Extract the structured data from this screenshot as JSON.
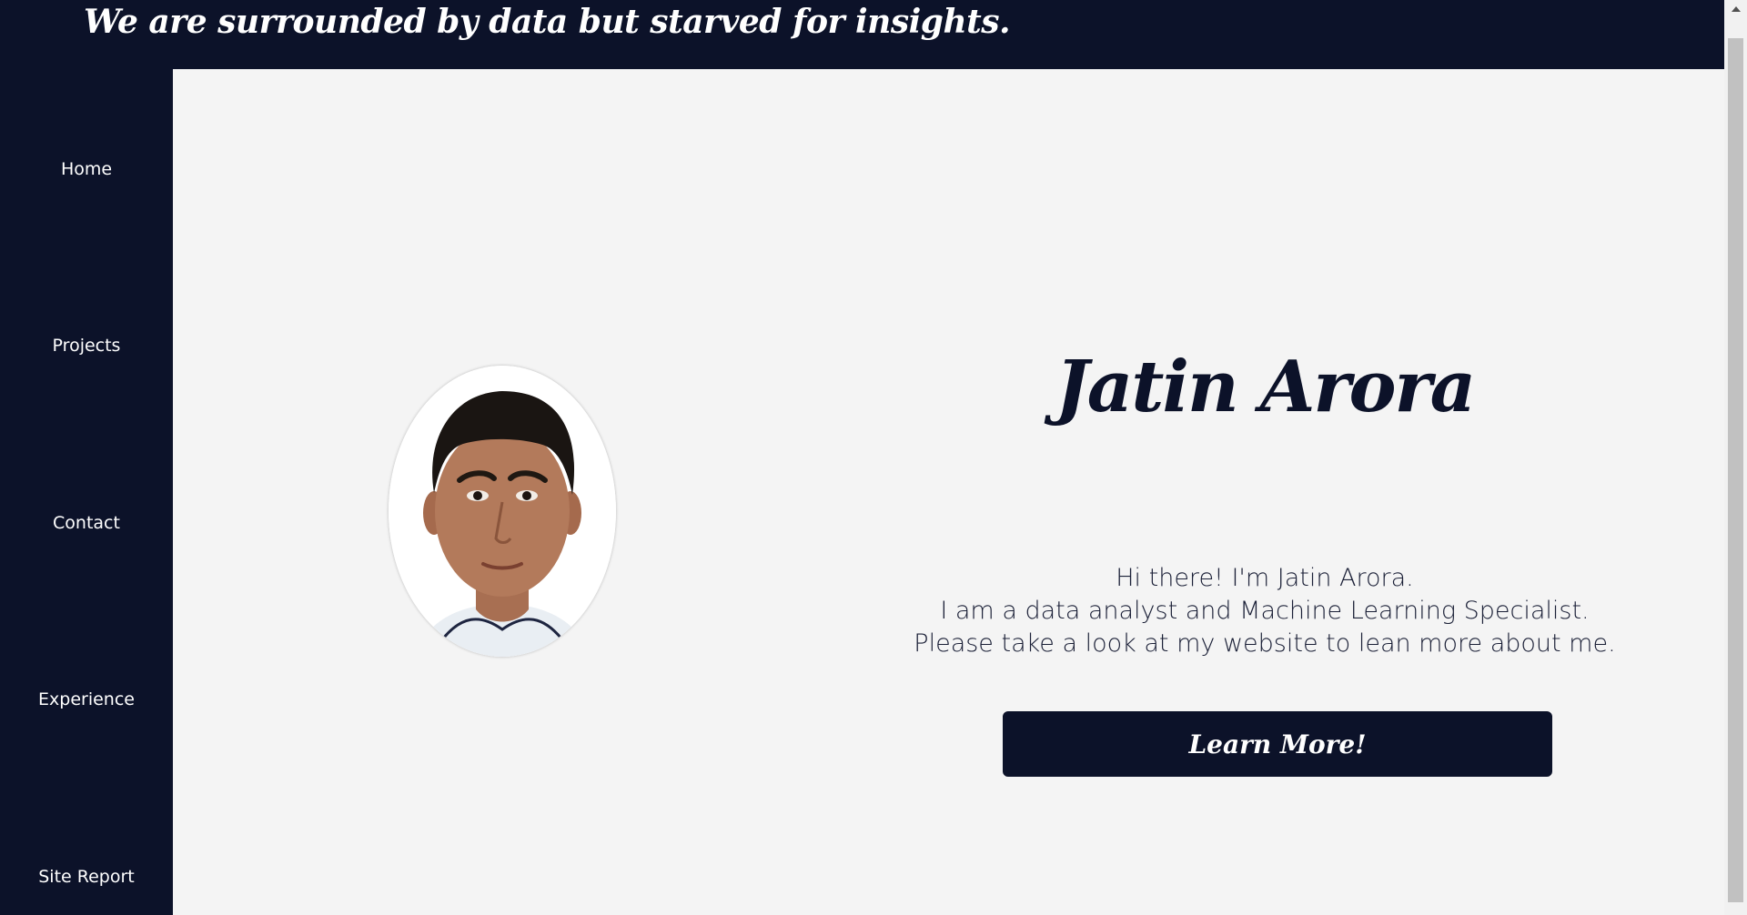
{
  "header": {
    "tagline": "We are surrounded by data but starved for insights."
  },
  "sidebar": {
    "items": [
      {
        "label": "Home"
      },
      {
        "label": "Projects"
      },
      {
        "label": "Contact"
      },
      {
        "label": "Experience"
      },
      {
        "label": "Site Report"
      }
    ]
  },
  "hero": {
    "name": "Jatin Arora",
    "intro_lines": [
      "Hi there! I'm Jatin Arora.",
      "I am a data analyst and Machine Learning Specialist.",
      "Please take a look at my website to lean more about me."
    ],
    "button_label": "Learn More!",
    "photo_icon": "profile-photo"
  },
  "colors": {
    "navy": "#0c1229",
    "content_bg": "#f4f4f4",
    "text": "#1b2037",
    "white": "#ffffff"
  }
}
